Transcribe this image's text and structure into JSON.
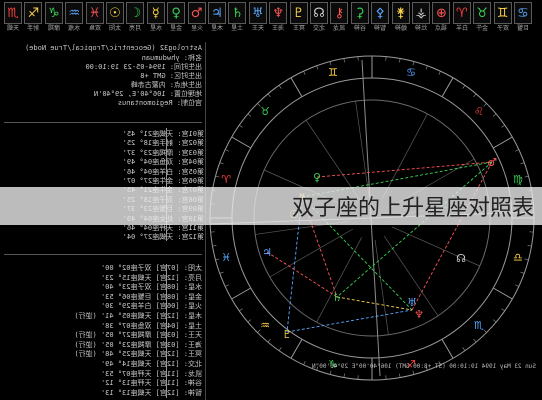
{
  "toolbar": {
    "items": [
      {
        "glyph": "♏",
        "label": "天蝎",
        "color": "#ff4040"
      },
      {
        "glyph": "♐",
        "label": "射手",
        "color": "#ffd54a"
      },
      {
        "glyph": "♑",
        "label": "摩羯",
        "color": "#39d353"
      },
      {
        "glyph": "♒",
        "label": "水瓶",
        "color": "#5aa7ff"
      },
      {
        "glyph": "♓",
        "label": "双鱼",
        "color": "#ff5555"
      },
      {
        "glyph": "☉",
        "label": "太阳",
        "color": "#ffd54a"
      },
      {
        "glyph": "☽",
        "label": "月亮",
        "color": "#39d353"
      },
      {
        "glyph": "☿",
        "label": "水星",
        "color": "#ffd54a"
      },
      {
        "glyph": "♀",
        "label": "金星",
        "color": "#39d353"
      },
      {
        "glyph": "♂",
        "label": "火星",
        "color": "#ff5555"
      },
      {
        "glyph": "♃",
        "label": "木星",
        "color": "#5aa7ff"
      },
      {
        "glyph": "♄",
        "label": "土星",
        "color": "#39d353"
      },
      {
        "glyph": "♅",
        "label": "天王",
        "color": "#5aa7ff"
      },
      {
        "glyph": "♆",
        "label": "海王",
        "color": "#ff5555"
      },
      {
        "glyph": "♇",
        "label": "冥王",
        "color": "#ffd54a"
      },
      {
        "glyph": "☊",
        "label": "北交",
        "color": "#cfcfcf"
      },
      {
        "glyph": "⚷",
        "label": "凯龙",
        "color": "#ff5555"
      },
      {
        "glyph": "⚳",
        "label": "谷神",
        "color": "#39d353"
      },
      {
        "glyph": "⚴",
        "label": "智神",
        "color": "#5aa7ff"
      },
      {
        "glyph": "⚵",
        "label": "婚神",
        "color": "#ffd54a"
      },
      {
        "glyph": "⚶",
        "label": "灶神",
        "color": "#cfcfcf"
      },
      {
        "glyph": "⊕",
        "label": "福点",
        "color": "#ff5555"
      },
      {
        "glyph": "♈",
        "label": "白羊",
        "color": "#ff4040"
      },
      {
        "glyph": "♉",
        "label": "金牛",
        "color": "#39d353"
      },
      {
        "glyph": "♊",
        "label": "双子",
        "color": "#ffd54a"
      },
      {
        "glyph": "♋",
        "label": "巨蟹",
        "color": "#5aa7ff"
      }
    ]
  },
  "info": {
    "header": "Astrolog32 (Geocentric/Tropical/True Node)",
    "name": "名称: yhwdumuan",
    "date": "出生时间: 1994-05-23 19:10:00",
    "zone": "出生时区: GMT +8",
    "place": "出生地点: 内蒙古赤峰",
    "coords": "地理位置: 106°40'E, 29°40'N",
    "house_system": "宫位制: Regiomontanus"
  },
  "houses": [
    "第01宫: 天蝎座21° 45'",
    "第02宫: 射手座18° 25'",
    "第03宫: 摩羯座23° 37'",
    "第04宫: 双鱼座04° 49'",
    "第05宫: 白羊座04° 46'",
    "第06宫: 金牛座27° 07'",
    "第07宫: 金牛座21° 45'",
    "第08宫: 双子座18° 25'",
    "第09宫: 巨蟹座23° 37'",
    "第10宫: 处女座04° 49'",
    "第11宫: 天秤座04° 46'",
    "第12宫: 天蝎座27° 04'"
  ],
  "planets": [
    "太阳: [07宫] 双子座02° 00'",
    "月亮: [12宫] 天蝎座15° 23'",
    "水星: [08宫] 双子座23° 40'",
    "金星: [08宫] 巨蟹座06° 53'",
    "火星: [06宫] 白羊座29° 30'",
    "木星: [12宫] 天蝎座05° 41' (逆行)",
    "土星: [04宫] 双鱼座07° 38'",
    "天王: [03宫] 摩羯座27° 05' (逆行)",
    "海王: [03宫] 摩羯座23° 05' (逆行)",
    "冥王: [12宫] 天蝎座25° 48' (逆行)",
    "北交: [12宫] 天蝎座14° 49'",
    "凯龙: [11宫] 天秤座07° 53'",
    "谷神: [11宫] 天秤座13° 12'",
    "智神: [12宫] 天蝎座13° 13'"
  ],
  "wheel": {
    "footer": "Sun 23 May 1994 19:10:00 (ST +8:00 GMT) 106°40'00\"E 29°40'00\"N"
  },
  "banner": {
    "title": "双子座的上升星座对照表"
  }
}
